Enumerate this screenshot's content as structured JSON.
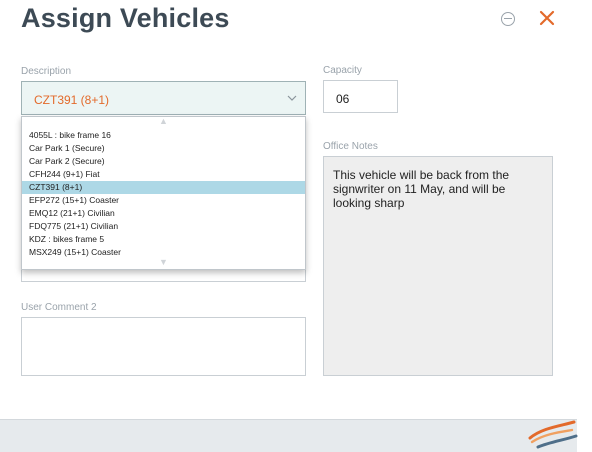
{
  "header": {
    "title": "Assign Vehicles",
    "minimize_icon": "minus-circle-icon",
    "close_icon": "close-x-icon",
    "close_color": "#e36a2b"
  },
  "description": {
    "label": "Description",
    "value": "CZT391 (8+1)",
    "options": [
      "4055L : bike frame 16",
      "Car Park 1 (Secure)",
      "Car Park 2 (Secure)",
      "CFH244 (9+1) Fiat",
      "CZT391 (8+1)",
      "EFP272 (15+1) Coaster",
      "EMQ12 (21+1) Civilian",
      "FDQ775 (21+1) Civilian",
      "KDZ : bikes frame 5",
      "MSX249 (15+1) Coaster"
    ],
    "selected_option": "CZT391 (8+1)",
    "highlight_color": "#add8e6",
    "value_color": "#e36a2b"
  },
  "capacity": {
    "label": "Capacity",
    "value": "06"
  },
  "office_notes": {
    "label": "Office Notes",
    "value": "This vehicle will be back from the signwriter on 11 May, and will be looking sharp"
  },
  "user_comment_2": {
    "label": "User Comment 2",
    "value": ""
  },
  "footer": {
    "logo_icon": "swoosh-logo-icon"
  }
}
